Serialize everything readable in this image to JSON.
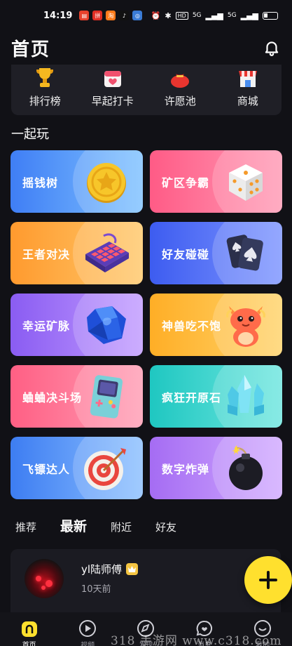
{
  "status_bar": {
    "time": "14:19",
    "apps": [
      {
        "icon": "app-icon-red",
        "color": "#e8412c"
      },
      {
        "icon": "app-icon-pdd",
        "color": "#e02e24"
      },
      {
        "icon": "app-icon-orange",
        "color": "#ff7a1a"
      },
      {
        "icon": "tiktok-icon",
        "color": "#111111"
      },
      {
        "icon": "app-icon-blue",
        "color": "#3a7bd5"
      }
    ],
    "signal_1": "5G",
    "signal_2": "5G",
    "hd": "HD"
  },
  "header": {
    "title": "首页"
  },
  "quick_actions": [
    {
      "label": "排行榜",
      "icon": "trophy-icon"
    },
    {
      "label": "早起打卡",
      "icon": "calendar-icon"
    },
    {
      "label": "许愿池",
      "icon": "lucky-bag-icon"
    },
    {
      "label": "商城",
      "icon": "shop-icon"
    }
  ],
  "section": {
    "title": "一起玩"
  },
  "games": [
    {
      "label": "摇钱树",
      "icon": "gold-coin-icon",
      "gradient": [
        "#3f7ef5",
        "#7fc2ff"
      ]
    },
    {
      "label": "矿区争霸",
      "icon": "dice-icon",
      "gradient": [
        "#ff5b86",
        "#ff9ab5"
      ]
    },
    {
      "label": "王者对决",
      "icon": "keyboard-icon",
      "gradient": [
        "#ff9a2e",
        "#ffc86a"
      ]
    },
    {
      "label": "好友碰碰",
      "icon": "playing-cards-icon",
      "gradient": [
        "#3d5cf0",
        "#7d95ff"
      ]
    },
    {
      "label": "幸运矿脉",
      "icon": "blue-gem-icon",
      "gradient": [
        "#8a5cf2",
        "#c19bff"
      ]
    },
    {
      "label": "神兽吃不饱",
      "icon": "dragon-icon",
      "gradient": [
        "#ffae26",
        "#ffd36a"
      ]
    },
    {
      "label": "蛐蛐决斗场",
      "icon": "game-console-icon",
      "gradient": [
        "#ff5f84",
        "#ff9db4"
      ]
    },
    {
      "label": "疯狂开原石",
      "icon": "crystal-icon",
      "gradient": [
        "#1fc7c1",
        "#6ee6df"
      ]
    },
    {
      "label": "飞镖达人",
      "icon": "dart-target-icon",
      "gradient": [
        "#3d7df2",
        "#8cc0ff"
      ]
    },
    {
      "label": "数字炸弹",
      "icon": "bomb-icon",
      "gradient": [
        "#a56cf3",
        "#d1aaff"
      ]
    }
  ],
  "feed_tabs": [
    {
      "label": "推荐",
      "active": false
    },
    {
      "label": "最新",
      "active": true
    },
    {
      "label": "附近",
      "active": false
    },
    {
      "label": "好友",
      "active": false
    }
  ],
  "post": {
    "username": "yl陆师傅",
    "time": "10天前",
    "badge_icon": "vip-badge-icon"
  },
  "fab": {
    "icon": "plus-icon"
  },
  "tab_bar": [
    {
      "label": "首页",
      "icon": "home-icon",
      "active": true
    },
    {
      "label": "视频",
      "icon": "play-icon",
      "active": false
    },
    {
      "label": "发现",
      "icon": "compass-icon",
      "active": false
    },
    {
      "label": "消息",
      "icon": "message-icon",
      "active": false
    },
    {
      "label": "我的",
      "icon": "profile-icon",
      "active": false
    }
  ],
  "watermark": "318 手游网 www.c318.com"
}
